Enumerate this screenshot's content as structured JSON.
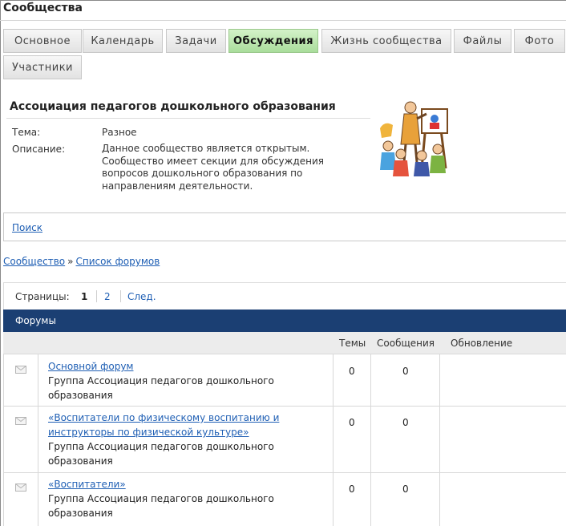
{
  "page": {
    "title": "Сообщества"
  },
  "tabs": [
    {
      "label": "Основное"
    },
    {
      "label": "Календарь"
    },
    {
      "label": "Задачи"
    },
    {
      "label": "Обсуждения"
    },
    {
      "label": "Жизнь сообщества"
    },
    {
      "label": "Файлы"
    },
    {
      "label": "Фото"
    },
    {
      "label": "Участники"
    }
  ],
  "group": {
    "name": "Ассоциация педагогов дошкольного образования",
    "topic_label": "Тема:",
    "topic_value": "Разное",
    "description_label": "Описание:",
    "description_value": "Данное сообщество является открытым. Сообщество имеет секции для обсуждения вопросов дошкольного образования по направлениям деятельности."
  },
  "search": {
    "link": "Поиск"
  },
  "breadcrumb": {
    "community": "Сообщество",
    "separator": "»",
    "forum_list": "Список форумов"
  },
  "pager": {
    "label": "Страницы:",
    "current": "1",
    "page2": "2",
    "next": "След."
  },
  "forums": {
    "title": "Форумы",
    "columns": {
      "topics": "Темы",
      "messages": "Сообщения",
      "updated": "Обновление"
    },
    "rows": [
      {
        "name": "Основной форум",
        "group": "Группа Ассоциация педагогов дошкольного образования",
        "topics": "0",
        "messages": "0",
        "updated": ""
      },
      {
        "name": "«Воспитатели по физическому воспитанию и инструкторы по физической культуре»",
        "group": "Группа Ассоциация педагогов дошкольного образования",
        "topics": "0",
        "messages": "0",
        "updated": ""
      },
      {
        "name": "«Воспитатели»",
        "group": "Группа Ассоциация педагогов дошкольного образования",
        "topics": "0",
        "messages": "0",
        "updated": ""
      }
    ]
  },
  "icons": {
    "message": "envelope-icon",
    "illustration": "teacher-with-children-icon"
  },
  "colors": {
    "active_tab": "#a9dd9b",
    "forum_bar": "#1b3f73",
    "link": "#1f5fb4"
  }
}
